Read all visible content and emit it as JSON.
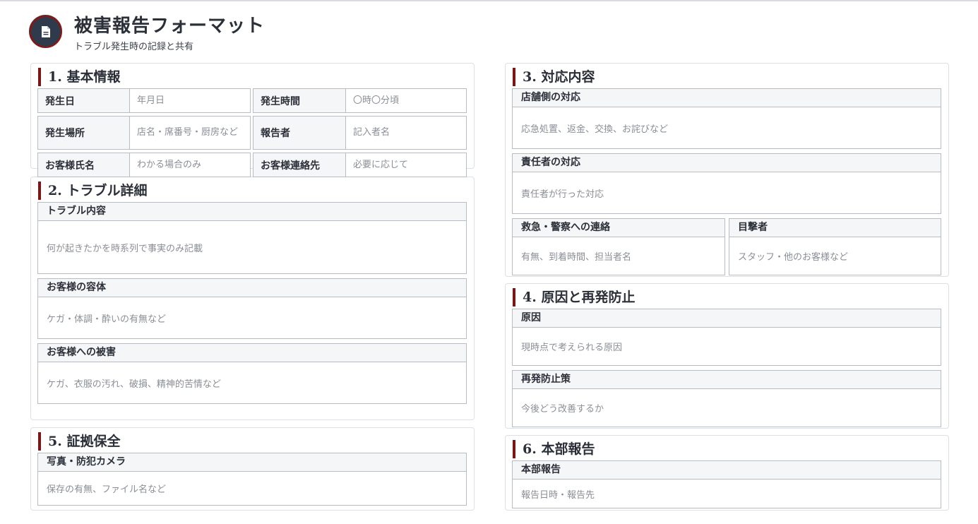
{
  "header": {
    "title": "被害報告フォーマット",
    "subtitle": "トラブル発生時の記録と共有",
    "logo_icon": "document-icon"
  },
  "sections": {
    "basic": {
      "title": "1. 基本情報",
      "rows": [
        {
          "label1": "発生日",
          "value1": "年月日",
          "label2": "発生時間",
          "value2": "〇時〇分頃"
        },
        {
          "label1": "発生場所",
          "value1": "店名・席番号・厨房など",
          "label2": "報告者",
          "value2": "記入者名"
        },
        {
          "label1": "お客様氏名",
          "value1": "わかる場合のみ",
          "label2": "お客様連絡先",
          "value2": "必要に応じて"
        }
      ]
    },
    "trouble": {
      "title": "2. トラブル詳細",
      "fields": [
        {
          "label": "トラブル内容",
          "value": "何が起きたかを時系列で事実のみ記載"
        },
        {
          "label": "お客様の容体",
          "value": "ケガ・体調・酔いの有無など"
        },
        {
          "label": "お客様への被害",
          "value": "ケガ、衣服の汚れ、破損、精神的苦情など"
        }
      ]
    },
    "evidence": {
      "title": "5. 証拠保全",
      "fields": [
        {
          "label": "写真・防犯カメラ",
          "value": "保存の有無、ファイル名など"
        }
      ]
    },
    "response": {
      "title": "3. 対応内容",
      "fields": [
        {
          "label": "店舗側の対応",
          "value": "応急処置、返金、交換、お詫びなど"
        },
        {
          "label": "責任者の対応",
          "value": "責任者が行った対応"
        },
        {
          "label": "救急・警察への連絡",
          "value": "有無、到着時間、担当者名"
        },
        {
          "label": "目撃者",
          "value": "スタッフ・他のお客様など"
        }
      ]
    },
    "cause": {
      "title": "4. 原因と再発防止",
      "fields": [
        {
          "label": "原因",
          "value": "現時点で考えられる原因"
        },
        {
          "label": "再発防止策",
          "value": "今後どう改善するか"
        }
      ]
    },
    "hq": {
      "title": "6. 本部報告",
      "fields": [
        {
          "label": "本部報告",
          "value": "報告日時・報告先"
        }
      ]
    }
  },
  "colors": {
    "accent": "#7a1616",
    "logo_bg": "#2f3a4d",
    "label_bg": "#f5f6f8",
    "border": "#b9bcc2",
    "placeholder_text": "#8a8e96"
  }
}
